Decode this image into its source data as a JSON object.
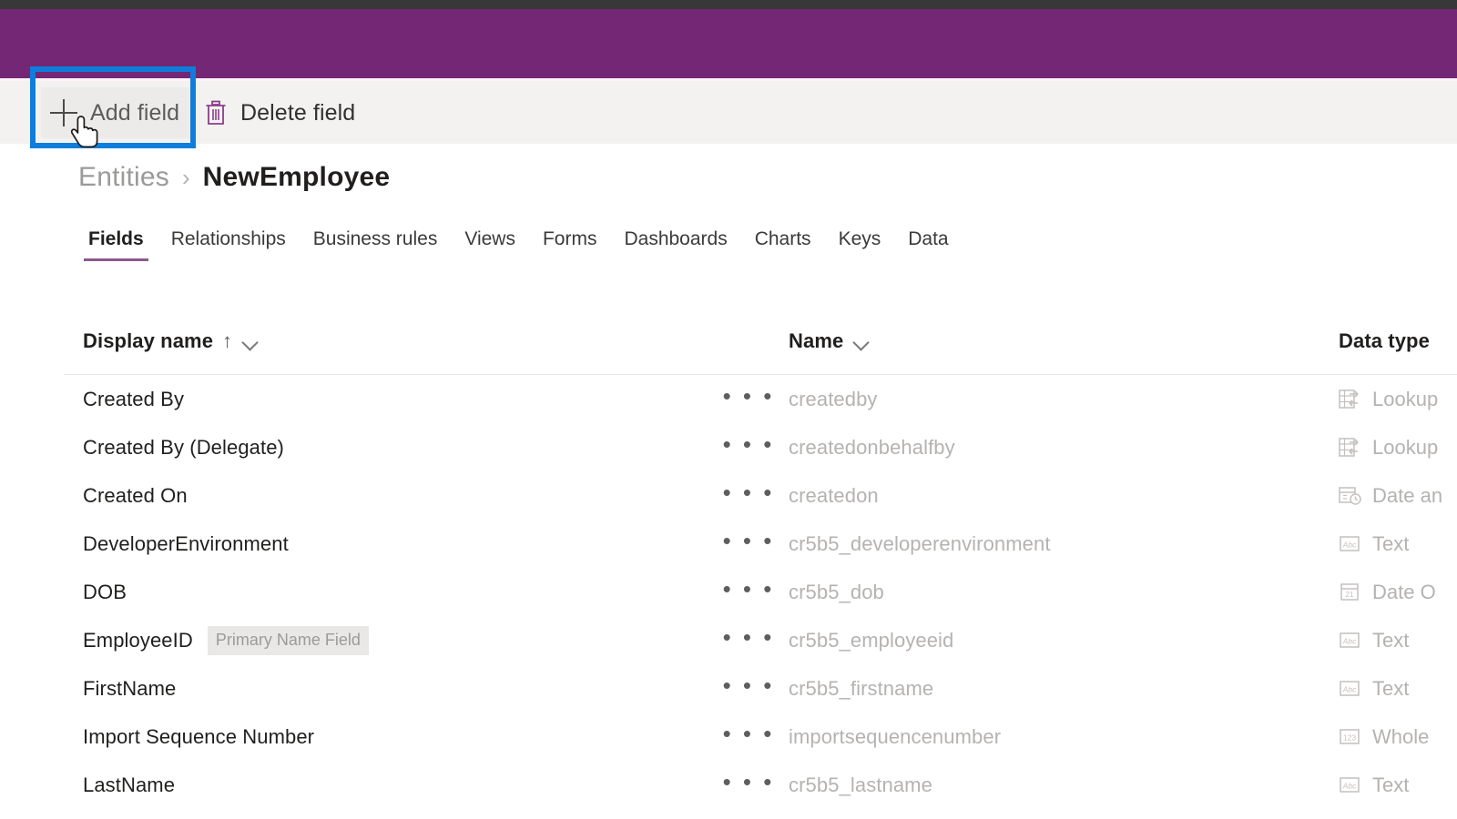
{
  "theme": {
    "header_purple": "#742774",
    "focus_blue": "#0f7ddb",
    "tab_underline": "#8a5a8a",
    "toolbar_bg": "#f3f2f1"
  },
  "command_bar": {
    "add_field": {
      "label": "Add field",
      "icon": "plus-icon",
      "focused": true
    },
    "delete_field": {
      "label": "Delete field",
      "icon": "trash-icon"
    }
  },
  "breadcrumb": {
    "parent": "Entities",
    "separator": "›",
    "current": "NewEmployee"
  },
  "tabs": [
    {
      "label": "Fields",
      "active": true
    },
    {
      "label": "Relationships",
      "active": false
    },
    {
      "label": "Business rules",
      "active": false
    },
    {
      "label": "Views",
      "active": false
    },
    {
      "label": "Forms",
      "active": false
    },
    {
      "label": "Dashboards",
      "active": false
    },
    {
      "label": "Charts",
      "active": false
    },
    {
      "label": "Keys",
      "active": false
    },
    {
      "label": "Data",
      "active": false
    }
  ],
  "grid": {
    "columns": [
      {
        "key": "display_name",
        "label": "Display name",
        "sort": "↑",
        "has_chevron": true
      },
      {
        "key": "name",
        "label": "Name",
        "has_chevron": true
      },
      {
        "key": "data_type",
        "label": "Data type",
        "has_chevron": false,
        "truncated": true
      }
    ],
    "row_menu_glyph": "• • •",
    "rows": [
      {
        "display_name": "Created By",
        "badge": null,
        "name": "createdby",
        "data_type": "Lookup",
        "type_icon": "lookup-icon"
      },
      {
        "display_name": "Created By (Delegate)",
        "badge": null,
        "name": "createdonbehalfby",
        "data_type": "Lookup",
        "type_icon": "lookup-icon"
      },
      {
        "display_name": "Created On",
        "badge": null,
        "name": "createdon",
        "data_type": "Date an",
        "type_icon": "date-time-icon"
      },
      {
        "display_name": "DeveloperEnvironment",
        "badge": null,
        "name": "cr5b5_developerenvironment",
        "data_type": "Text",
        "type_icon": "text-icon"
      },
      {
        "display_name": "DOB",
        "badge": null,
        "name": "cr5b5_dob",
        "data_type": "Date O",
        "type_icon": "date-only-icon"
      },
      {
        "display_name": "EmployeeID",
        "badge": "Primary Name Field",
        "name": "cr5b5_employeeid",
        "data_type": "Text",
        "type_icon": "text-icon"
      },
      {
        "display_name": "FirstName",
        "badge": null,
        "name": "cr5b5_firstname",
        "data_type": "Text",
        "type_icon": "text-icon"
      },
      {
        "display_name": "Import Sequence Number",
        "badge": null,
        "name": "importsequencenumber",
        "data_type": "Whole",
        "type_icon": "number-icon"
      },
      {
        "display_name": "LastName",
        "badge": null,
        "name": "cr5b5_lastname",
        "data_type": "Text",
        "type_icon": "text-icon"
      }
    ]
  }
}
